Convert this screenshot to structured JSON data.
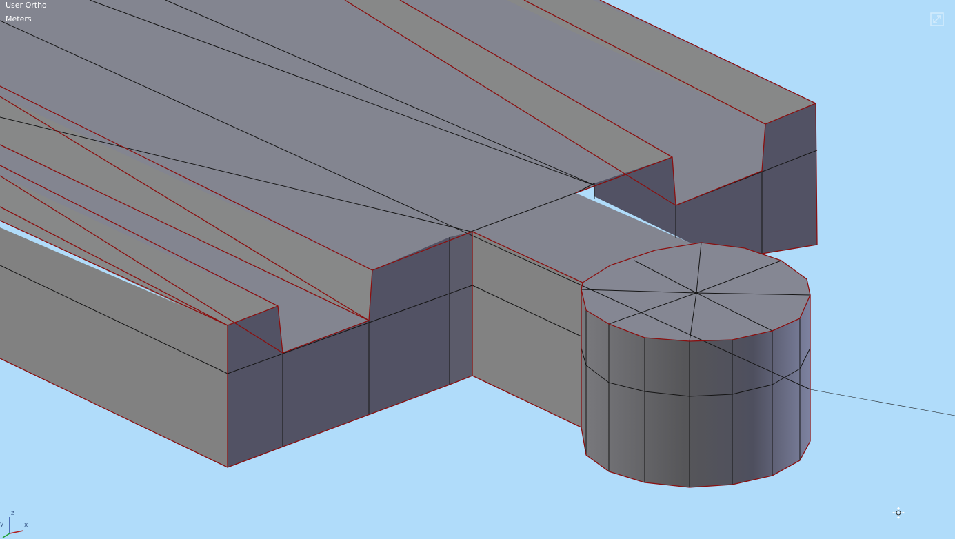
{
  "viewport": {
    "view_name": "User Ortho",
    "units": "Meters",
    "background_color": "#b0dcfa",
    "selection_edge_color": "#8a1010",
    "wire_edge_color": "#111111"
  },
  "icons": {
    "maximize": "maximize-icon",
    "axis_gizmo": "axis-gizmo-icon",
    "cursor": "move-cursor-icon"
  },
  "axes": {
    "z": "z",
    "x": "x",
    "y": "y"
  }
}
